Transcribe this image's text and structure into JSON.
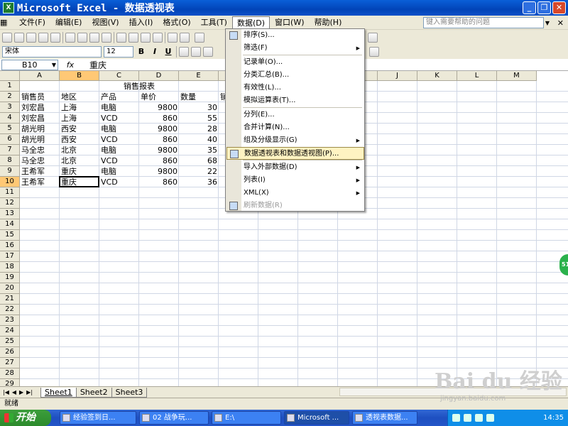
{
  "window": {
    "title": "Microsoft Excel - 数据透视表",
    "minimize": "_",
    "restore": "❐",
    "close": "✕"
  },
  "menubar": {
    "items": [
      "文件(F)",
      "编辑(E)",
      "视图(V)",
      "插入(I)",
      "格式(O)",
      "工具(T)",
      "数据(D)",
      "窗口(W)",
      "帮助(H)"
    ],
    "help_placeholder": "键入需要帮助的问题"
  },
  "format_toolbar": {
    "font": "宋体",
    "size": "12",
    "bold": "B",
    "italic": "I",
    "underline": "U"
  },
  "formula_bar": {
    "name_box": "B10",
    "fx": "fx",
    "value": "重庆"
  },
  "columns": [
    "A",
    "B",
    "C",
    "D",
    "E",
    "F",
    "G",
    "H",
    "I",
    "J",
    "K",
    "L",
    "M"
  ],
  "selected_column": "B",
  "rows": [
    "1",
    "2",
    "3",
    "4",
    "5",
    "6",
    "7",
    "8",
    "9",
    "10",
    "11",
    "12",
    "13",
    "14",
    "15",
    "16",
    "17",
    "18",
    "19",
    "20",
    "21",
    "22",
    "23",
    "24",
    "25",
    "26",
    "27",
    "28",
    "29"
  ],
  "selected_row": "10",
  "sheet": {
    "title": "销售报表",
    "headers": [
      "销售员",
      "地区",
      "产品",
      "单价",
      "数量",
      "销"
    ],
    "data": [
      [
        "刘宏昌",
        "上海",
        "电脑",
        "9800",
        "30"
      ],
      [
        "刘宏昌",
        "上海",
        "VCD",
        "860",
        "55"
      ],
      [
        "胡光明",
        "西安",
        "电脑",
        "9800",
        "28"
      ],
      [
        "胡光明",
        "西安",
        "VCD",
        "860",
        "40"
      ],
      [
        "马全忠",
        "北京",
        "电脑",
        "9800",
        "35"
      ],
      [
        "马全忠",
        "北京",
        "VCD",
        "860",
        "68"
      ],
      [
        "王希军",
        "重庆",
        "电脑",
        "9800",
        "22"
      ],
      [
        "王希军",
        "重庆",
        "VCD",
        "860",
        "36"
      ]
    ]
  },
  "data_menu": {
    "items": [
      {
        "label": "排序(S)...",
        "arrow": ""
      },
      {
        "label": "筛选(F)",
        "arrow": "▶"
      },
      {
        "label": "记录单(O)...",
        "arrow": ""
      },
      {
        "label": "分类汇总(B)...",
        "arrow": ""
      },
      {
        "label": "有效性(L)...",
        "arrow": ""
      },
      {
        "label": "模拟运算表(T)...",
        "arrow": ""
      },
      {
        "label": "分列(E)...",
        "arrow": ""
      },
      {
        "label": "合并计算(N)...",
        "arrow": ""
      },
      {
        "label": "组及分级显示(G)",
        "arrow": "▶"
      },
      {
        "label": "数据透视表和数据透视图(P)...",
        "arrow": ""
      },
      {
        "label": "导入外部数据(D)",
        "arrow": "▶"
      },
      {
        "label": "列表(I)",
        "arrow": "▶"
      },
      {
        "label": "XML(X)",
        "arrow": "▶"
      },
      {
        "label": "刷新数据(R)",
        "arrow": ""
      }
    ]
  },
  "sheet_tabs": [
    "Sheet1",
    "Sheet2",
    "Sheet3"
  ],
  "status_text": "就绪",
  "taskbar": {
    "start": "开始",
    "tasks": [
      "经验签到日...",
      "02 战争玩...",
      "E:\\",
      "Microsoft ...",
      "透视表数据..."
    ],
    "clock": "14:35"
  },
  "watermark": {
    "text": "Bai du 经验",
    "url": "jingyan.baidu.com"
  },
  "side_bubble": "51"
}
